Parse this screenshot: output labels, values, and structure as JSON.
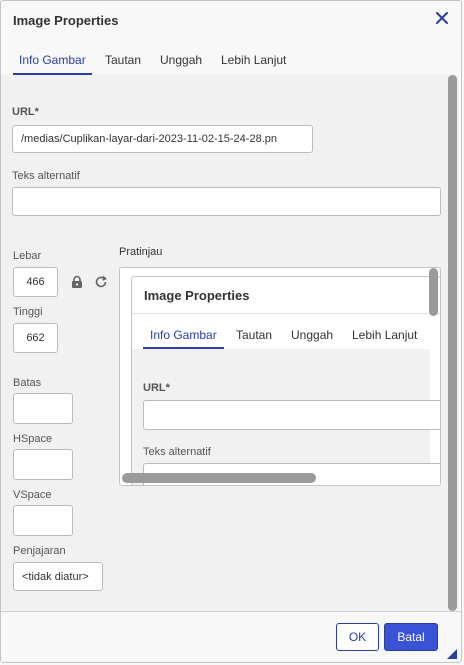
{
  "dialog": {
    "title": "Image Properties",
    "close_icon": "close-icon"
  },
  "tabs": [
    {
      "label": "Info Gambar",
      "active": true
    },
    {
      "label": "Tautan",
      "active": false
    },
    {
      "label": "Unggah",
      "active": false
    },
    {
      "label": "Lebih Lanjut",
      "active": false
    }
  ],
  "form": {
    "url_label": "URL*",
    "url_value": "/medias/Cuplikan-layar-dari-2023-11-02-15-24-28.pn",
    "alt_label": "Teks alternatif",
    "alt_value": "",
    "width_label": "Lebar",
    "width_value": "466",
    "height_label": "Tinggi",
    "height_value": "662",
    "border_label": "Batas",
    "border_value": "",
    "hspace_label": "HSpace",
    "hspace_value": "",
    "vspace_label": "VSpace",
    "vspace_value": "",
    "align_label": "Penjajaran",
    "align_value": "<tidak diatur>",
    "preview_label": "Pratinjau"
  },
  "preview": {
    "title": "Image Properties",
    "tabs": [
      "Info Gambar",
      "Tautan",
      "Unggah",
      "Lebih Lanjut"
    ],
    "url_label": "URL*",
    "alt_label": "Teks alternatif"
  },
  "footer": {
    "ok_label": "OK",
    "cancel_label": "Batal"
  },
  "colors": {
    "accent": "#2b3ea1",
    "primary_button": "#3a52d6"
  }
}
